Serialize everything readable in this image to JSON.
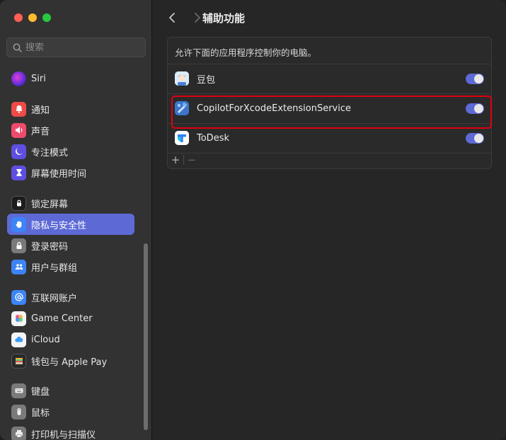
{
  "window": {
    "title": "辅助功能"
  },
  "search": {
    "placeholder": "搜索"
  },
  "sidebar": {
    "items": [
      {
        "label": "Siri",
        "icon": "siri-icon",
        "color": "#8b3fe0"
      },
      {
        "label": "通知",
        "icon": "bell-icon",
        "color": "#ef4b47"
      },
      {
        "label": "声音",
        "icon": "speaker-icon",
        "color": "#ef4b6c"
      },
      {
        "label": "专注模式",
        "icon": "moon-icon",
        "color": "#5f4fe0"
      },
      {
        "label": "屏幕使用时间",
        "icon": "hourglass-icon",
        "color": "#5f4fe0"
      },
      {
        "label": "锁定屏幕",
        "icon": "lock-screen-icon",
        "color": "#1c1c1c"
      },
      {
        "label": "隐私与安全性",
        "icon": "hand-icon",
        "color": "#3d84f7",
        "active": true
      },
      {
        "label": "登录密码",
        "icon": "padlock-icon",
        "color": "#7a7a7a"
      },
      {
        "label": "用户与群组",
        "icon": "users-icon",
        "color": "#3d84f7"
      },
      {
        "label": "互联网账户",
        "icon": "at-icon",
        "color": "#3d84f7"
      },
      {
        "label": "Game Center",
        "icon": "game-center-icon",
        "color": "#f7f7f7"
      },
      {
        "label": "iCloud",
        "icon": "cloud-icon",
        "color": "#f7f7f7"
      },
      {
        "label": "钱包与 Apple Pay",
        "icon": "wallet-icon",
        "color": "#2a2a2a"
      },
      {
        "label": "键盘",
        "icon": "keyboard-icon",
        "color": "#7a7a7a"
      },
      {
        "label": "鼠标",
        "icon": "mouse-icon",
        "color": "#7a7a7a"
      },
      {
        "label": "打印机与扫描仪",
        "icon": "printer-icon",
        "color": "#7a7a7a"
      }
    ]
  },
  "main": {
    "description": "允许下面的应用程序控制你的电脑。",
    "apps": [
      {
        "name": "豆包",
        "icon": "doubao-icon",
        "enabled": true
      },
      {
        "name": "CopilotForXcodeExtensionService",
        "icon": "copilot-xcode-icon",
        "enabled": true
      },
      {
        "name": "ToDesk",
        "icon": "todesk-icon",
        "enabled": true
      }
    ],
    "footer": {
      "add": "+",
      "remove": "−"
    }
  },
  "colors": {
    "accent": "#5d6ad6",
    "highlight": "#e0000f"
  }
}
